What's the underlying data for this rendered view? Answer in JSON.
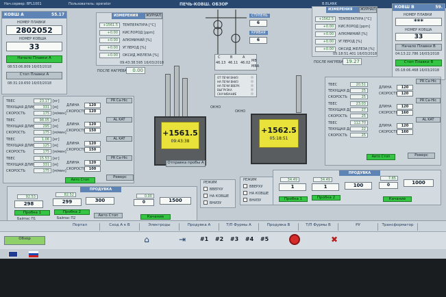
{
  "topbar": {
    "title": "ПЕЧЬ-КОВШ. ОБЗОР",
    "operator_label": "Пользователь: operator",
    "left_label": "Нач.сервер: BFL1001",
    "right_label": "B.BLANK"
  },
  "ladle_a": {
    "title": "КОВШ А",
    "value": "55.17",
    "ladle_num_label": "НОМЕР ПЛАВКИ",
    "ladle_num": "2802052",
    "ladle_no_label": "НОМЕР КОВША",
    "ladle_no": "33",
    "start_btn": "Начало Плавки А",
    "start_time": "08:53:06.809 16/03/2018",
    "stop_btn": "Стоп Плавки А",
    "stop_time": "08:31:19.650 16/03/2018"
  },
  "ladle_b": {
    "title": "КОВШ В",
    "value": "59.",
    "ladle_num_label": "НОМЕР ПЛАВКИ",
    "ladle_num": "***",
    "ladle_no_label": "НОМЕР КОВША",
    "ladle_no": "33",
    "start_btn": "Начало Плавки В",
    "start_time": "04:13:22.786 16/03/2018",
    "stop_btn": "Стоп Плавки В",
    "stop_time": "05:18:06.468 16/03/2018"
  },
  "measure_a": {
    "title": "ИЗМЕРЕНИЯ",
    "journal": "ЖУРНАЛ",
    "rows": [
      {
        "v": "+1561.5",
        "l": "ТЕМПЕРАТУРА [°C]"
      },
      {
        "v": "+0.00",
        "l": "КИСЛОРОД [ppm]"
      },
      {
        "v": "+0.00",
        "l": "АЛЮМИНИЙ [%]"
      },
      {
        "v": "+0.00",
        "l": "УГЛЕРОД [%]"
      },
      {
        "v": "+0.00",
        "l": "ОКСИД ЖЕЛЕЗА [%]"
      }
    ],
    "time": "09:43:38.595 16/03/2018",
    "after_heat_label": "ПОСЛЕ НАГРЕВА",
    "after_heat": "0.00"
  },
  "measure_b": {
    "title": "ИЗМЕРЕНИЯ",
    "journal": "ЖУРНАЛ",
    "rows": [
      {
        "v": "+1562.5",
        "l": "ТЕМПЕРАТУРА [°C]"
      },
      {
        "v": "+0.00",
        "l": "КИСЛОРОД [ppm]"
      },
      {
        "v": "+0.00",
        "l": "АЛЮМИНИЙ [%]"
      },
      {
        "v": "+0.00",
        "l": "УГЛЕРОД [%]"
      },
      {
        "v": "+0.00",
        "l": "ОКСИД ЖЕЛЕЗА [%]"
      }
    ],
    "time": "05:18:51.401 16/03/2018",
    "after_heat_label": "ПОСЛЕ НАГРЕВА",
    "after_heat": "19.27"
  },
  "transformer": {
    "step_label": "СТУПЕНЬ",
    "step": "6",
    "curve_label": "КРИВАЯ",
    "curve": "6",
    "cols": [
      "C",
      "B",
      "A"
    ],
    "currents": [
      "46.13",
      "46.11",
      "46.02"
    ],
    "mw_label": "МВ",
    "mva_label": "МВА"
  },
  "ladle_a_melt": {
    "temp": "+1561.5",
    "time": "09:43:38"
  },
  "ladle_b_melt": {
    "temp": "+1562.5",
    "time": "05:18:51"
  },
  "window_label": "ОКНО",
  "sample_btn": "Отправка пробы А",
  "wire_a": {
    "rows": [
      {
        "t": "ТВЕС",
        "v": "23.17",
        "u": "[кг]"
      },
      {
        "t": "ТЕКУЩАЯ ДЛИНА",
        "v": "331",
        "u": "[м]"
      },
      {
        "t": "СКОРОСТЬ",
        "v": "175",
        "u": "[м/мин]"
      }
    ],
    "rows2": [
      {
        "t": "ТВЕС",
        "v": "98.05",
        "u": "[кг]"
      },
      {
        "t": "ТЕКУЩАЯ ДЛИНА",
        "v": "295",
        "u": "[м]"
      },
      {
        "t": "СКОРОСТЬ",
        "v": "175",
        "u": "[м/мин]"
      }
    ],
    "rows3": [
      {
        "t": "ТВЕС",
        "v": "1.06",
        "u": "[кг]"
      },
      {
        "t": "ТЕКУЩАЯ ДЛИНА",
        "v": "125",
        "u": "[м]"
      },
      {
        "t": "СКОРОСТЬ",
        "v": "175",
        "u": "[м/мин]"
      }
    ],
    "rows4": [
      {
        "t": "ТВЕС",
        "v": "15.53",
        "u": "[кг]"
      },
      {
        "t": "ТЕКУЩАЯ ДЛИНА",
        "v": "331",
        "u": "[м]"
      },
      {
        "t": "СКОРОСТЬ",
        "v": "175",
        "u": "[м/мин]"
      }
    ],
    "right": [
      {
        "t": "ДЛИНА",
        "v": "120"
      },
      {
        "t": "СКОРОСТЬ",
        "v": "120"
      },
      {
        "t": "ДЛИНА",
        "v": "120"
      },
      {
        "t": "СКОРОСТЬ",
        "v": "150"
      },
      {
        "t": "ДЛИНА",
        "v": "120"
      },
      {
        "t": "СКОРОСТЬ",
        "v": "150"
      },
      {
        "t": "ДЛИНА",
        "v": "120"
      },
      {
        "t": "СКОРОСТЬ",
        "v": "100"
      }
    ],
    "tags": [
      "PR Ca-Hic",
      "AL KAT",
      "AL KAT",
      "PR Ca-Hic"
    ],
    "auto": "Авто Стоп",
    "reverse": "Реверс"
  },
  "wire_b": {
    "rows": [
      {
        "t": "ТВЕС",
        "v": "20.51"
      },
      {
        "t": "ТЕКУЩАЯ ДЛИНА",
        "v": "25"
      },
      {
        "t": "СКОРОСТЬ",
        "v": "25"
      },
      {
        "t": "ТВЕС",
        "v": "23.03"
      },
      {
        "t": "ТЕКУЩАЯ ДЛИНА",
        "v": "27"
      },
      {
        "t": "СКОРОСТЬ",
        "v": "25"
      },
      {
        "t": "ТВЕС",
        "v": "112.70"
      },
      {
        "t": "ТЕКУЩАЯ ДЛИНА",
        "v": "22"
      },
      {
        "t": "СКОРОСТЬ",
        "v": "25"
      }
    ],
    "right": [
      {
        "t": "ДЛИНА",
        "v": "120"
      },
      {
        "t": "СКОРОСТЬ",
        "v": "120"
      },
      {
        "t": "ДЛИНА",
        "v": "120"
      },
      {
        "t": "СКОРОСТЬ",
        "v": "160"
      },
      {
        "t": "ДЛИНА",
        "v": "120"
      },
      {
        "t": "СКОРОСТЬ",
        "v": "160"
      }
    ],
    "tags": [
      "PR Ca-Hic",
      "PR Ca-Hic",
      "AL KAT"
    ],
    "auto": "Авто Стоп",
    "reverse": "Реверс"
  },
  "purge_a": {
    "title": "ПРОДУВКА",
    "p1_small": "92.53",
    "p1": "298",
    "p2_small": "82.52",
    "p2": "299",
    "flow": "300",
    "btn1": "Пробка 1",
    "btn2": "Пробка 2",
    "bypass1": "Байпас П1",
    "bypass2": "Байпас П2",
    "auto": "Авто Стоп",
    "k_small": "0.00",
    "k": "0",
    "k_total": "1500",
    "k_btn": "Качание"
  },
  "purge_b": {
    "title": "ПРОДУВКА",
    "p1_small": "34.49",
    "p1": "1",
    "p2_small": "34.49",
    "p2": "1",
    "flow": "100",
    "btn1": "Пробка 1",
    "btn2": "Пробка 2",
    "k_small": "7.85",
    "k": "0",
    "k_total": "1000",
    "k_btn": "Качание"
  },
  "mode_a": {
    "title": "РЕЖИМ",
    "items": [
      "ВВЕРХУ",
      "НА КОВШЕ",
      "ВНИЗУ"
    ]
  },
  "mode_b": {
    "title": "РЕЖИМ",
    "items": [
      "ВВЕРХУ",
      "НА КОВШЕ",
      "ВНИЗУ"
    ]
  },
  "hood_list": [
    "ОТ ПЕЧИ ВНИЗ",
    "НА ПЕЧИ ВНИЗ",
    "НА ПЕЧИ ВВЕРХ",
    "ВЫГРУЗКА",
    "СКАЧИВАНИЕ"
  ],
  "tabs": [
    "Обзор",
    "Портал",
    "Сход А к В",
    "Электроды",
    "Продувка А",
    "Т/П Фурмы А",
    "Продувка В",
    "Т/П Фурмы В",
    "РУ",
    "Трансформатор"
  ],
  "taskbar": {
    "nav": [
      "#1",
      "#2",
      "#3",
      "#4",
      "#5"
    ]
  }
}
